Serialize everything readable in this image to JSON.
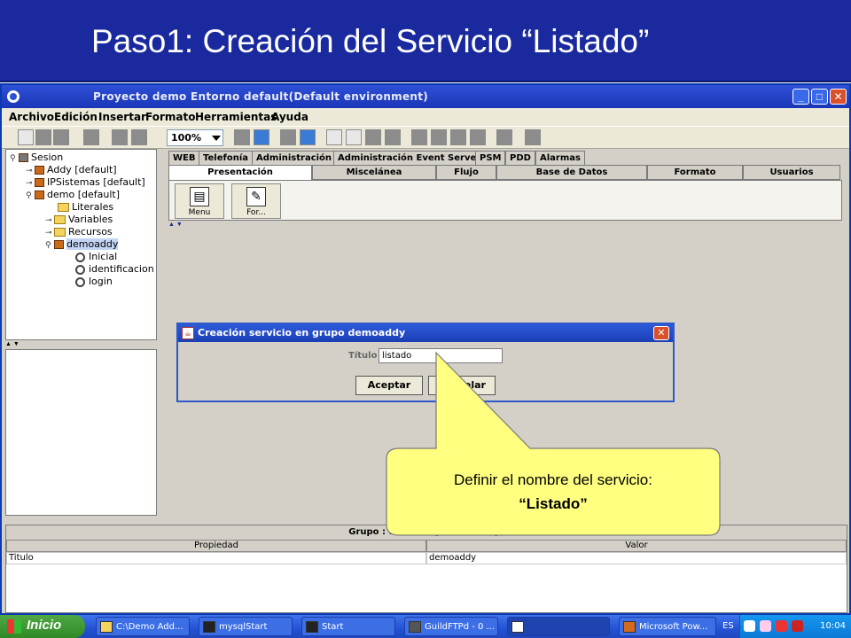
{
  "slide": {
    "title": "Paso1: Creación del Servicio “Listado”"
  },
  "window": {
    "title": "Proyecto demo Entorno default(Default environment)"
  },
  "menu": [
    "Archivo",
    "Edición",
    "Insertar",
    "Formato",
    "Herramientas",
    "Ayuda"
  ],
  "toolbar": {
    "zoom": "100%"
  },
  "tree": {
    "items": [
      {
        "label": "Sesion",
        "icon": "session-icon",
        "indent": 0
      },
      {
        "label": "Addy [default]",
        "icon": "cube-icon",
        "indent": 1
      },
      {
        "label": "IPSistemas [default]",
        "icon": "cube-icon",
        "indent": 1
      },
      {
        "label": "demo [default]",
        "icon": "cube-icon",
        "indent": 1
      },
      {
        "label": "Literales",
        "icon": "folder-icon",
        "indent": 2
      },
      {
        "label": "Variables",
        "icon": "folder-icon",
        "indent": 2
      },
      {
        "label": "Recursos",
        "icon": "folder-icon",
        "indent": 2
      },
      {
        "label": "demoaddy",
        "icon": "cube-icon",
        "indent": 2
      },
      {
        "label": "Inicial",
        "icon": "gear-icon",
        "indent": 3
      },
      {
        "label": "identificacion",
        "icon": "gear-icon",
        "indent": 3
      },
      {
        "label": "login",
        "icon": "gear-icon",
        "indent": 3
      }
    ]
  },
  "tabs_top": [
    "WEB",
    "Telefonía",
    "Administración",
    "Administración Event Server",
    "PSM",
    "PDD",
    "Alarmas"
  ],
  "tabs_bottom": [
    "Presentación",
    "Miscelánea",
    "Flujo",
    "Base de Datos",
    "Formato",
    "Usuarios"
  ],
  "palette": [
    "Menu",
    "For..."
  ],
  "dialog": {
    "title": "Creación servicio en grupo demoaddy",
    "field_label": "Título",
    "field_value": "listado",
    "ok": "Aceptar",
    "cancel": "Cancelar"
  },
  "bottom_panel": {
    "title": "Grupo : demoaddy (demoaddy)",
    "col_property": "Propiedad",
    "col_value": "Valor",
    "row_property": "Titulo",
    "row_value": "demoaddy"
  },
  "taskbar": {
    "start": "Inicio",
    "tasks": [
      "C:\\Demo Add...",
      "mysqlStart",
      "Start",
      "GuildFTPd - 0 ...",
      "",
      "Microsoft Pow..."
    ],
    "lang": "ES",
    "clock": "10:04"
  },
  "callout": {
    "line1": "Definir el nombre del servicio:",
    "line2": "“Listado”"
  },
  "colors": {
    "slide_bar": "#1a2a9e",
    "callout_fill": "#ffff80",
    "xp_blue": "#2452d4"
  }
}
